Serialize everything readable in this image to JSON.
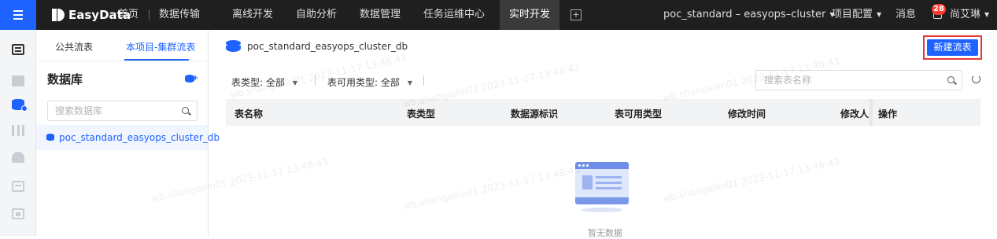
{
  "nav": {
    "brand": "EasyData",
    "items": [
      "首页",
      "数据传输",
      "离线开发",
      "自助分析",
      "数据管理",
      "任务运维中心",
      "实时开发"
    ],
    "active_item": "实时开发",
    "add_tab_glyph": "+",
    "project": "poc_standard – easyops–cluster",
    "config": "项目配置",
    "messages": "消息",
    "message_count": "28",
    "user": "尚艾琳",
    "accent": "#1e63ff"
  },
  "rail": {
    "icons": [
      "document-icon",
      "code-icon",
      "database-icon",
      "library-icon",
      "layers-icon",
      "archive-icon",
      "monitor-icon"
    ]
  },
  "db_panel": {
    "tabs": [
      "公共流表",
      "本项目-集群流表"
    ],
    "active_tab": "本项目-集群流表",
    "title": "数据库",
    "search_placeholder": "搜索数据库",
    "databases": [
      "poc_standard_easyops_cluster_db"
    ]
  },
  "main": {
    "breadcrumb": "poc_standard_easyops_cluster_db",
    "create_button": "新建流表",
    "filters": {
      "table_type": {
        "label": "表类型:",
        "value": "全部"
      },
      "usable_type": {
        "label": "表可用类型:",
        "value": "全部"
      }
    },
    "table_search_placeholder": "搜索表名称",
    "columns": [
      "表名称",
      "表类型",
      "数据源标识",
      "表可用类型",
      "修改时间",
      "修改人",
      "操作"
    ],
    "rows": [],
    "empty_text": "暂无数据"
  },
  "watermark": "wb.shangailin01 2023-11-17 13:48:43"
}
